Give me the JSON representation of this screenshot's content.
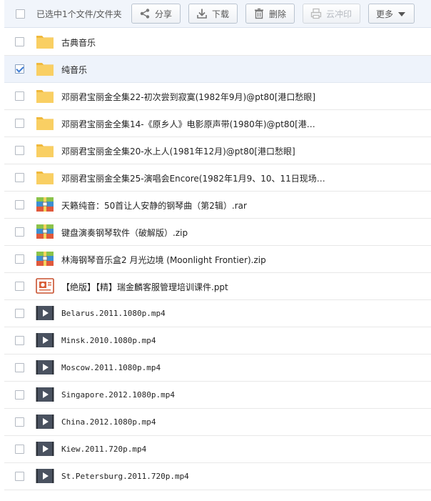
{
  "toolbar": {
    "selection_text": "已选中1个文件/文件夹",
    "share_label": "分享",
    "download_label": "下载",
    "delete_label": "删除",
    "cloud_print_label": "云冲印",
    "more_label": "更多"
  },
  "files": [
    {
      "name": "古典音乐",
      "type": "folder",
      "checked": false
    },
    {
      "name": "纯音乐",
      "type": "folder",
      "checked": true
    },
    {
      "name": "邓丽君宝丽金全集22-初次尝到寂寞(1982年9月)@pt80[港口愁眼]",
      "type": "folder",
      "checked": false
    },
    {
      "name": "邓丽君宝丽金全集14-《原乡人》电影原声带(1980年)@pt80[港…",
      "type": "folder",
      "checked": false
    },
    {
      "name": "邓丽君宝丽金全集20-水上人(1981年12月)@pt80[港口愁眼]",
      "type": "folder",
      "checked": false
    },
    {
      "name": "邓丽君宝丽金全集25-演唱会Encore(1982年1月9、10、11日现场…",
      "type": "folder",
      "checked": false
    },
    {
      "name": "天籁纯音：50首让人安静的钢琴曲（第2辑）.rar",
      "type": "archive",
      "checked": false
    },
    {
      "name": "键盘演奏钢琴软件（破解版）.zip",
      "type": "archive",
      "checked": false
    },
    {
      "name": "林海钢琴音乐盒2 月光边境 (Moonlight Frontier).zip",
      "type": "archive",
      "checked": false
    },
    {
      "name": "【绝版】【精】瑞金麟客服管理培训课件.ppt",
      "type": "ppt",
      "checked": false
    },
    {
      "name": "Belarus.2011.1080p.mp4",
      "type": "video",
      "checked": false
    },
    {
      "name": "Minsk.2010.1080p.mp4",
      "type": "video",
      "checked": false
    },
    {
      "name": "Moscow.2011.1080p.mp4",
      "type": "video",
      "checked": false
    },
    {
      "name": "Singapore.2012.1080p.mp4",
      "type": "video",
      "checked": false
    },
    {
      "name": "China.2012.1080p.mp4",
      "type": "video",
      "checked": false
    },
    {
      "name": "Kiew.2011.720p.mp4",
      "type": "video",
      "checked": false
    },
    {
      "name": "St.Petersburg.2011.720p.mp4",
      "type": "video",
      "checked": false
    }
  ],
  "colors": {
    "folder": "#f7c95a",
    "selected_row": "#eef3fb",
    "check": "#3b7bd4"
  }
}
